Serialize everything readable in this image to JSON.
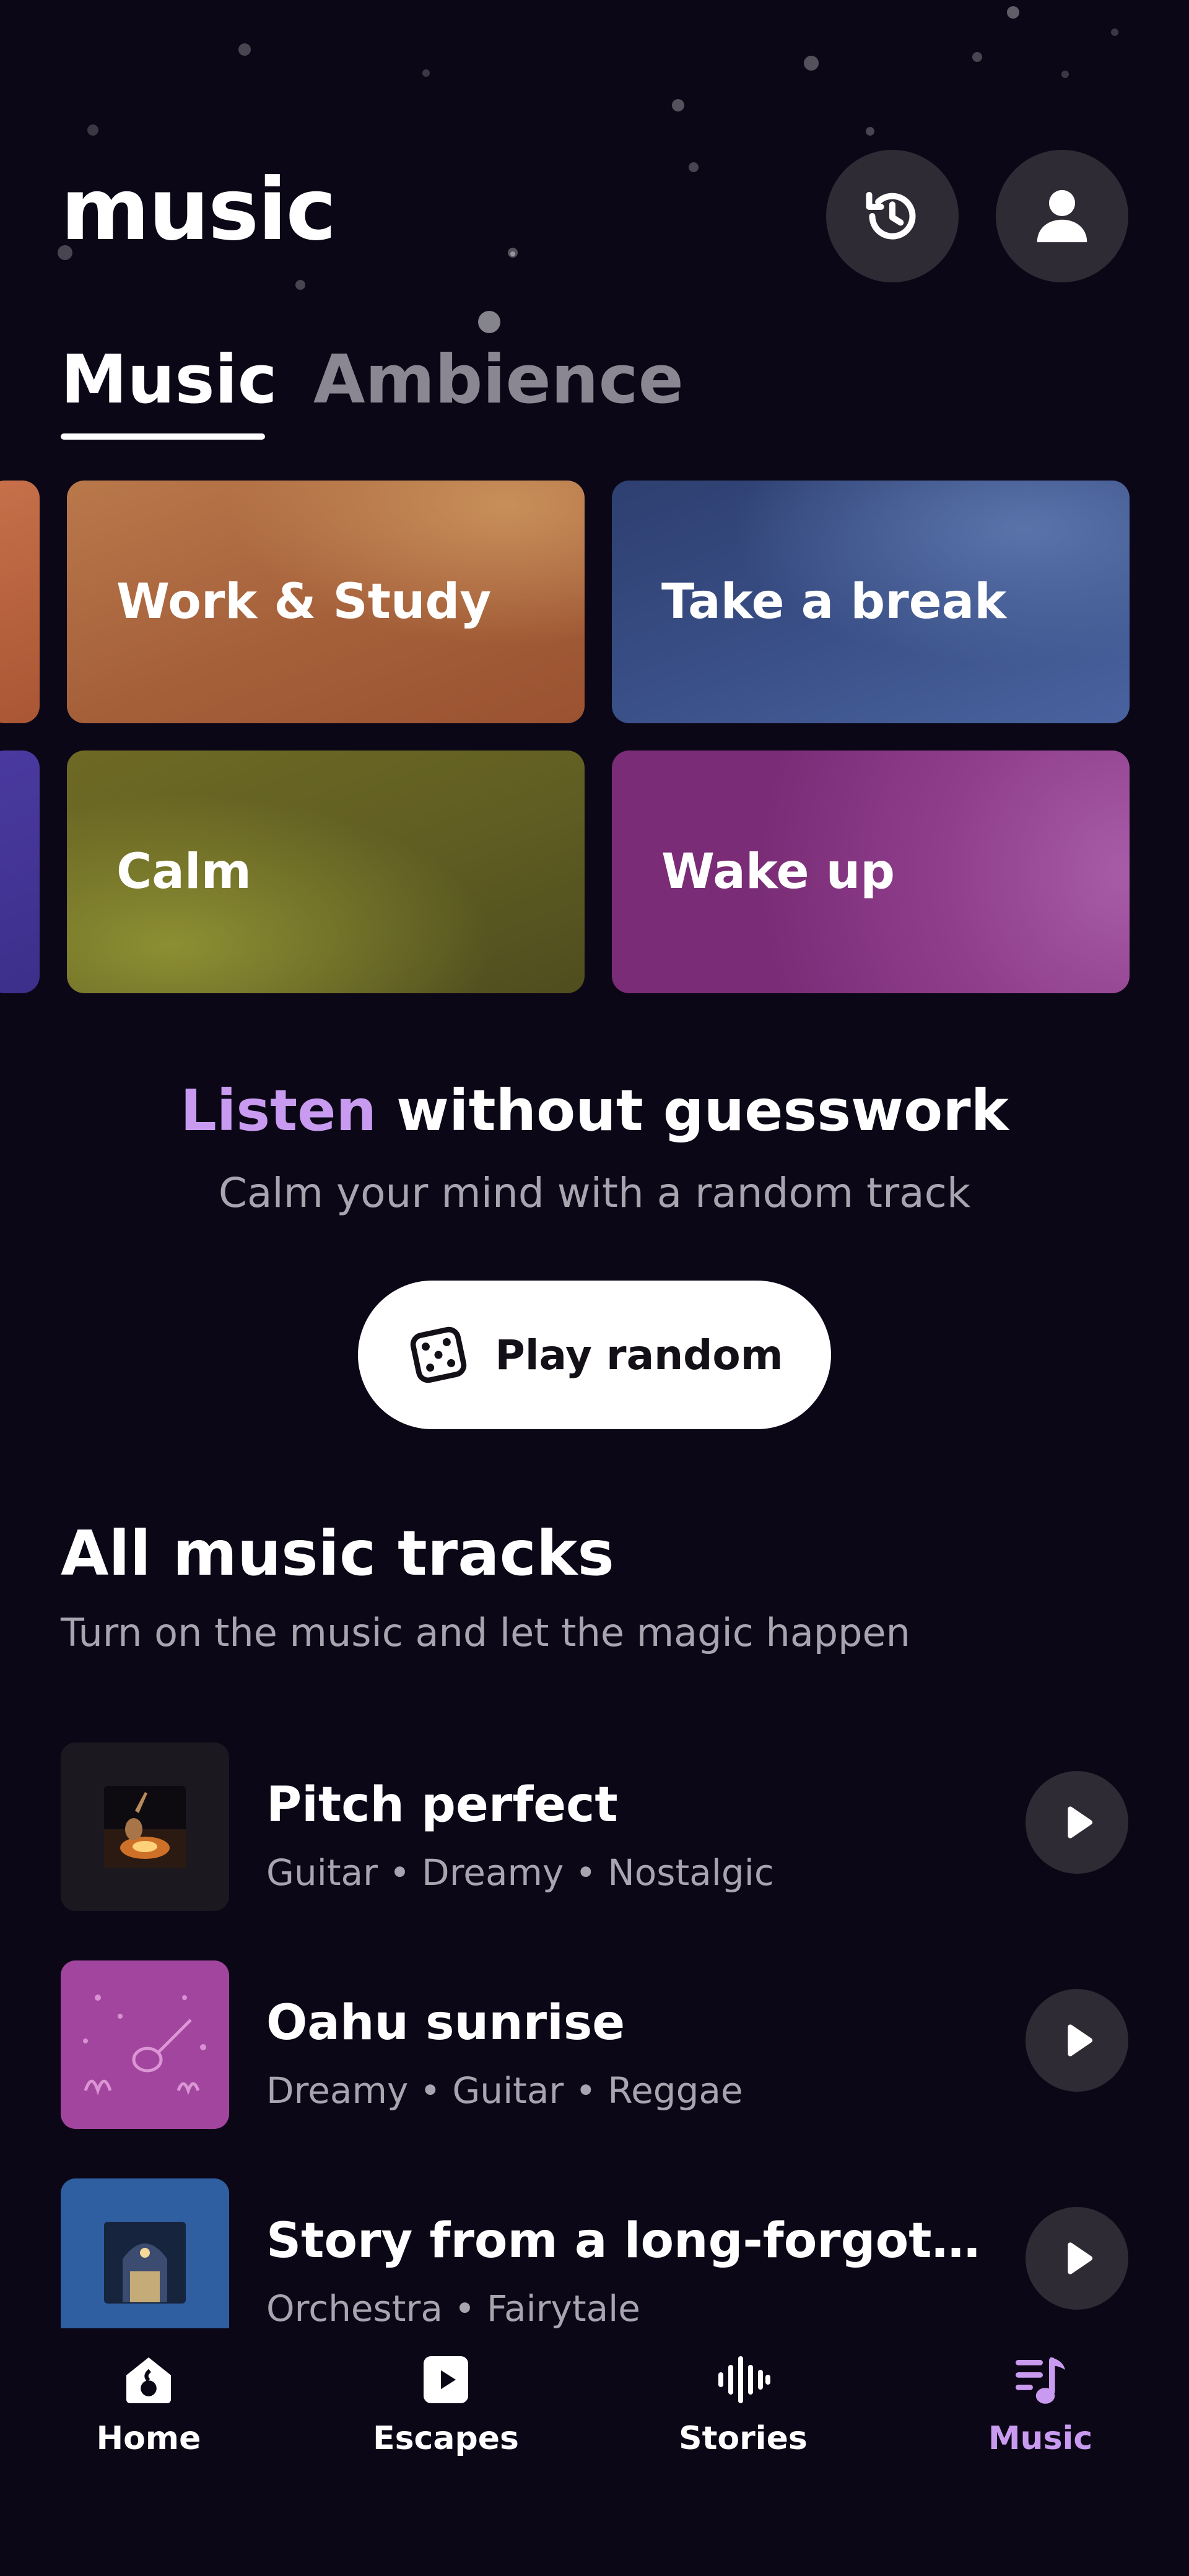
{
  "header": {
    "title": "music",
    "history_icon": "history-icon",
    "profile_icon": "profile-icon"
  },
  "tabs": [
    {
      "label": "Music",
      "active": true
    },
    {
      "label": "Ambience",
      "active": false
    }
  ],
  "categories": [
    {
      "label": "Work & Study"
    },
    {
      "label": "Take a break"
    },
    {
      "label": "Calm"
    },
    {
      "label": "Wake up"
    }
  ],
  "promo": {
    "title_accent": "Listen",
    "title_rest": " without guesswork",
    "subtitle": "Calm your mind with a random track",
    "button_label": "Play random",
    "button_icon": "dice-icon"
  },
  "tracks_section": {
    "title": "All music tracks",
    "subtitle": "Turn on the music and let the magic happen",
    "tracks": [
      {
        "title": "Pitch perfect",
        "tags": "Guitar • Dreamy • Nostalgic"
      },
      {
        "title": "Oahu sunrise",
        "tags": "Dreamy • Guitar • Reggae"
      },
      {
        "title": "Story from a long-forgotten b...",
        "tags": "Orchestra • Fairytale"
      }
    ]
  },
  "bottom_nav": [
    {
      "label": "Home",
      "icon": "home-icon",
      "active": false
    },
    {
      "label": "Escapes",
      "icon": "escapes-play-icon",
      "active": false
    },
    {
      "label": "Stories",
      "icon": "soundwave-icon",
      "active": false
    },
    {
      "label": "Music",
      "icon": "music-note-icon",
      "active": true
    }
  ],
  "colors": {
    "background": "#0b0716",
    "accent": "#c99bf0",
    "muted_text": "#a9a5b0",
    "button_dark": "#2e2b34"
  }
}
